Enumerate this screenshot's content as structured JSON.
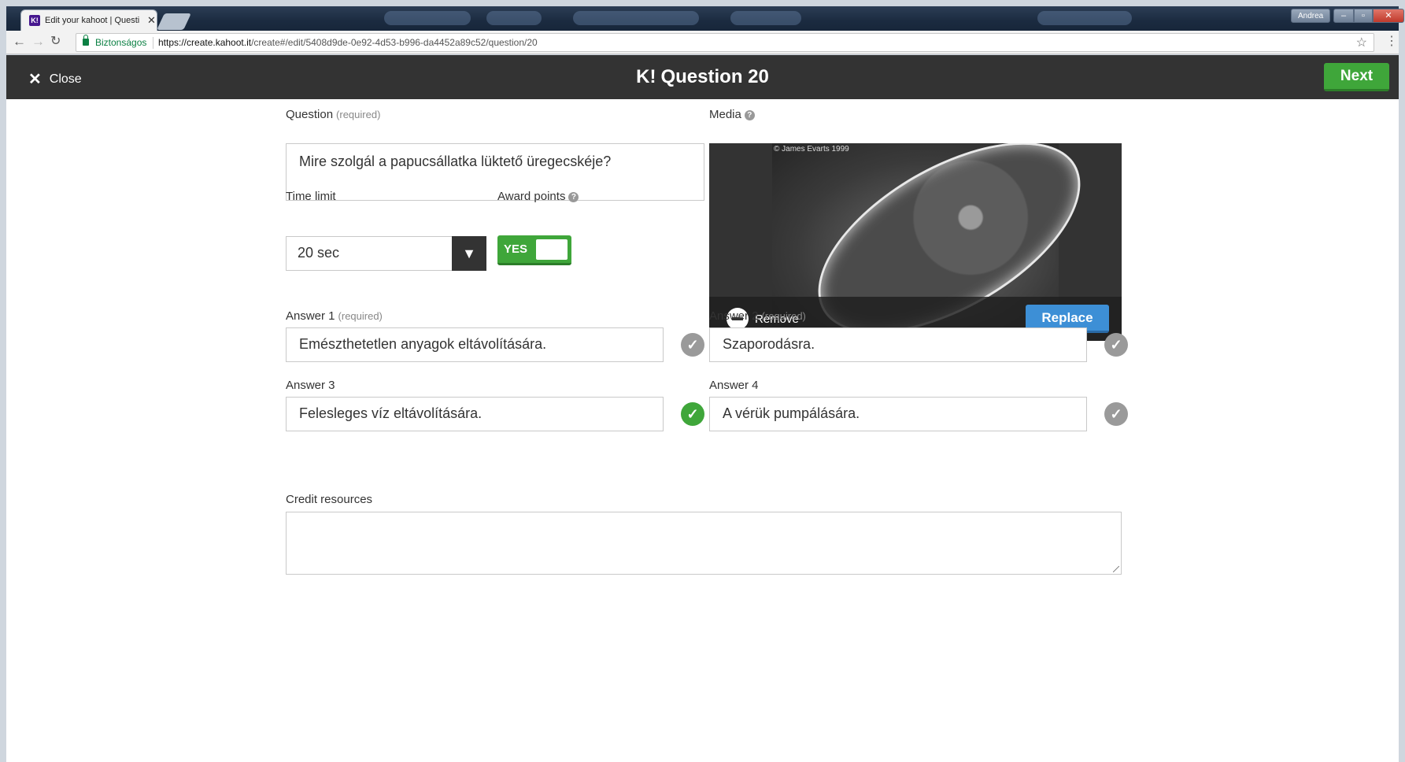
{
  "browser": {
    "tab_title": "Edit your kahoot | Questi",
    "favicon_text": "K!",
    "user_name": "Andrea",
    "security_label": "Biztonságos",
    "url_host": "https://create.kahoot.it",
    "url_path": "/create#/edit/5408d9de-0e92-4d53-b996-da4452a89c52/question/20"
  },
  "header": {
    "close_label": "Close",
    "logo": "K!",
    "title": "Question 20",
    "next_label": "Next"
  },
  "question": {
    "label": "Question",
    "required_hint": "(required)",
    "text": "Mire szolgál a papucsállatka lüktető üregecskéje?"
  },
  "time_limit": {
    "label": "Time limit",
    "value": "20 sec"
  },
  "award_points": {
    "label": "Award points",
    "toggle_text": "YES",
    "enabled": true
  },
  "media": {
    "label": "Media",
    "image_credit": "© James Evarts 1999",
    "image_subject": "paramecium micrograph",
    "remove_label": "Remove",
    "replace_label": "Replace"
  },
  "answers": [
    {
      "label": "Answer 1",
      "required_hint": "(required)",
      "text": "Emészthetetlen anyagok eltávolítására.",
      "correct": false
    },
    {
      "label": "Answer 2",
      "required_hint": "(required)",
      "text": "Szaporodásra.",
      "correct": false
    },
    {
      "label": "Answer 3",
      "required_hint": "",
      "text": "Felesleges víz eltávolítására.",
      "correct": true
    },
    {
      "label": "Answer 4",
      "required_hint": "",
      "text": "A vérük pumpálására.",
      "correct": false
    }
  ],
  "credit": {
    "label": "Credit resources",
    "value": ""
  },
  "colors": {
    "header_bg": "#333333",
    "primary_green": "#3fa63a",
    "replace_blue": "#3d8fd6",
    "check_inactive": "#9a9a9a"
  }
}
